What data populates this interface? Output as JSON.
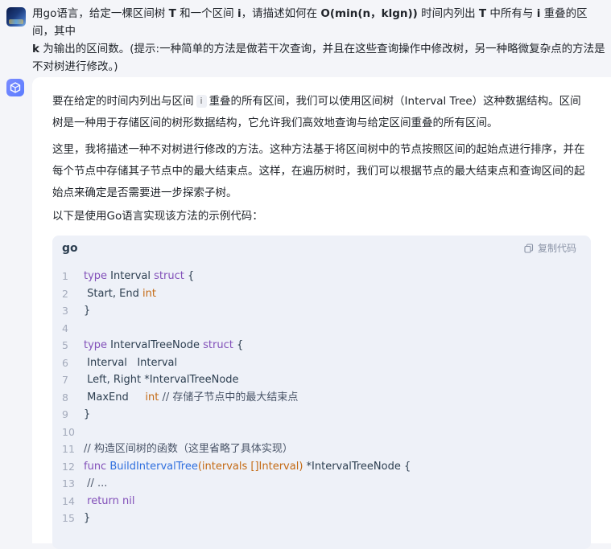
{
  "user": {
    "line1_a": "用go语言，给定一棵区间树 ",
    "line1_T": "T",
    "line1_b": " 和一个区间 ",
    "line1_i": "i",
    "line1_c": "，请描述如何在 ",
    "line1_big": "O(min(n，klgn))",
    "line1_d": " 时间内列出 ",
    "line1_T2": "T",
    "line1_e": " 中所有与 ",
    "line1_i2": "i",
    "line1_f": " 重叠的区间，其中",
    "line2_k": "k",
    "line2_a": " 为输出的区间数。(提示:一种简单的方法是做若干次查询，并且在这些查询操作中修改树，另一种略微复杂点的方法是",
    "line3": "不对树进行修改。)"
  },
  "answer": {
    "p1_a": "要在给定的时间内列出与区间",
    "p1_code": "i",
    "p1_b": "重叠的所有区间，我们可以使用区间树（Interval Tree）这种数据结构。区间树是一种用于存储区间的树形数据结构，它允许我们高效地查询与给定区间重叠的所有区间。",
    "p2": "这里，我将描述一种不对树进行修改的方法。这种方法基于将区间树中的节点按照区间的起始点进行排序，并在每个节点中存储其子节点中的最大结束点。这样，在遍历树时，我们可以根据节点的最大结束点和查询区间的起始点来确定是否需要进一步探索子树。",
    "p3": "以下是使用Go语言实现该方法的示例代码："
  },
  "code": {
    "language": "go",
    "copy_label": "复制代码",
    "copy_icon": "copy-icon",
    "lines": [
      {
        "n": "1",
        "t": "type Interval struct {"
      },
      {
        "n": "2",
        "t": " Start, End int"
      },
      {
        "n": "3",
        "t": "}"
      },
      {
        "n": "4",
        "t": ""
      },
      {
        "n": "5",
        "t": "type IntervalTreeNode struct {"
      },
      {
        "n": "6",
        "t": " Interval   Interval"
      },
      {
        "n": "7",
        "t": " Left, Right *IntervalTreeNode"
      },
      {
        "n": "8",
        "t": " MaxEnd     int // 存储子节点中的最大结束点"
      },
      {
        "n": "9",
        "t": "}"
      },
      {
        "n": "10",
        "t": ""
      },
      {
        "n": "11",
        "t": "// 构造区间树的函数（这里省略了具体实现）"
      },
      {
        "n": "12",
        "t": "func BuildIntervalTree(intervals []Interval) *IntervalTreeNode {"
      },
      {
        "n": "13",
        "t": " // ..."
      },
      {
        "n": "14",
        "t": " return nil"
      },
      {
        "n": "15",
        "t": "}"
      }
    ]
  },
  "colors": {
    "keyword": "#8250b9",
    "type": "#c46a14",
    "function": "#2f6fde",
    "code_bg": "#eef1f8"
  }
}
